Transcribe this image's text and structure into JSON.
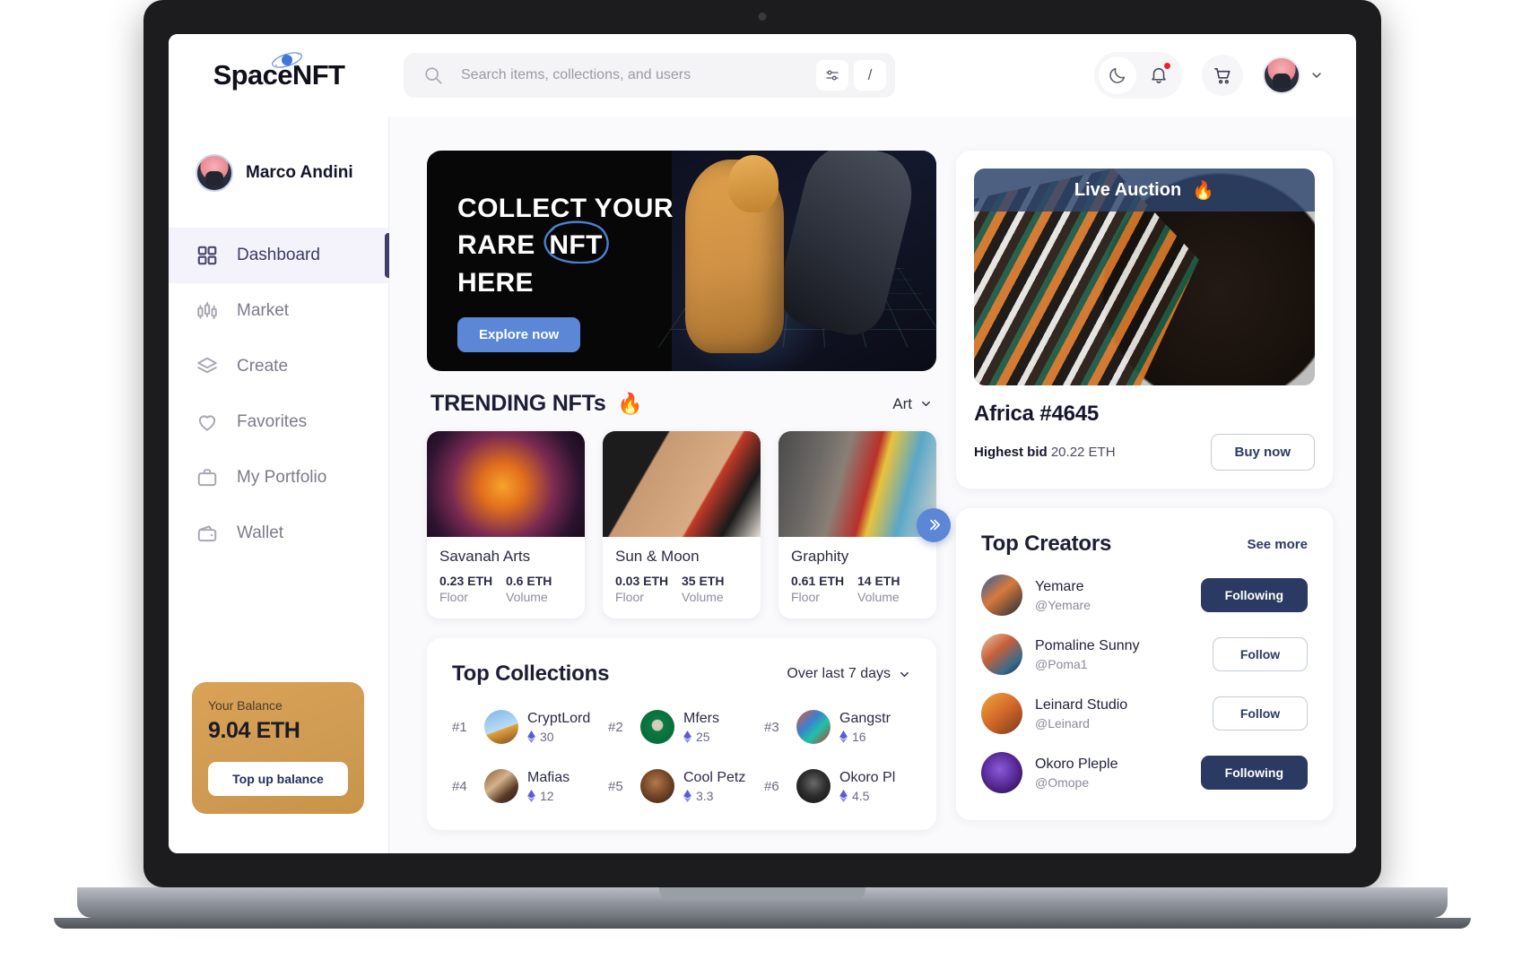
{
  "brand": {
    "name": "SpaceNFT",
    "logo_icon": "planet-orbit-icon"
  },
  "search": {
    "placeholder": "Search items, collections, and users",
    "value": "",
    "icon": "search-icon",
    "filter_icon": "sliders-icon",
    "shortcut_key": "/"
  },
  "topbar": {
    "dark_mode_icon": "moon-icon",
    "notifications_icon": "bell-icon",
    "has_notification": true,
    "cart_icon": "cart-icon",
    "profile_chevron_icon": "chevron-down-icon"
  },
  "sidebar": {
    "user": {
      "name": "Marco Andini",
      "avatar": "user-avatar"
    },
    "items": [
      {
        "label": "Dashboard",
        "icon": "grid-icon",
        "active": true
      },
      {
        "label": "Market",
        "icon": "candlestick-icon",
        "active": false
      },
      {
        "label": "Create",
        "icon": "layers-icon",
        "active": false
      },
      {
        "label": "Favorites",
        "icon": "heart-icon",
        "active": false
      },
      {
        "label": "My Portfolio",
        "icon": "briefcase-icon",
        "active": false
      },
      {
        "label": "Wallet",
        "icon": "wallet-icon",
        "active": false
      }
    ],
    "balance": {
      "label": "Your Balance",
      "amount": "9.04 ETH",
      "button": "Top up balance",
      "accent": "#d09a52"
    }
  },
  "hero": {
    "line1": "COLLECT YOUR",
    "line2_pre": "RARE",
    "line2_circled": "NFT",
    "line3": "HERE",
    "cta": "Explore now",
    "cta_color": "#5b87d6"
  },
  "trending": {
    "title": "TRENDING NFTs",
    "emoji": "🔥",
    "category": "Art",
    "category_chevron_icon": "chevron-down-icon",
    "next_icon": "chevron-double-right-icon",
    "cards": [
      {
        "name": "Savanah Arts",
        "floor_value": "0.23 ETH",
        "floor_label": "Floor",
        "volume_value": "0.6 ETH",
        "volume_label": "Volume"
      },
      {
        "name": "Sun & Moon",
        "floor_value": "0.03 ETH",
        "floor_label": "Floor",
        "volume_value": "35 ETH",
        "volume_label": "Volume"
      },
      {
        "name": "Graphity",
        "floor_value": "0.61 ETH",
        "floor_label": "Floor",
        "volume_value": "14 ETH",
        "volume_label": "Volume"
      }
    ]
  },
  "collections": {
    "title": "Top Collections",
    "range": "Over last 7 days",
    "range_chevron_icon": "chevron-down-icon",
    "items": [
      {
        "rank": "#1",
        "name": "CryptLord",
        "value": "30"
      },
      {
        "rank": "#2",
        "name": "Mfers",
        "value": "25"
      },
      {
        "rank": "#3",
        "name": "Gangstr",
        "value": "16"
      },
      {
        "rank": "#4",
        "name": "Mafias",
        "value": "12"
      },
      {
        "rank": "#5",
        "name": "Cool Petz",
        "value": "3.3"
      },
      {
        "rank": "#6",
        "name": "Okoro Pl",
        "value": "4.5"
      }
    ]
  },
  "auction": {
    "banner": "Live Auction",
    "banner_emoji": "🔥",
    "title": "Africa #4645",
    "bid_label": "Highest bid",
    "bid_value": "20.22 ETH",
    "buy_button": "Buy now"
  },
  "creators": {
    "title": "Top Creators",
    "see_more": "See more",
    "items": [
      {
        "name": "Yemare",
        "handle": "@Yemare",
        "action": "Following",
        "following": true
      },
      {
        "name": "Pomaline Sunny",
        "handle": "@Poma1",
        "action": "Follow",
        "following": false
      },
      {
        "name": "Leinard Studio",
        "handle": "@Leinard",
        "action": "Follow",
        "following": false
      },
      {
        "name": "Okoro Pleple",
        "handle": "@Omope",
        "action": "Following",
        "following": true
      }
    ]
  }
}
